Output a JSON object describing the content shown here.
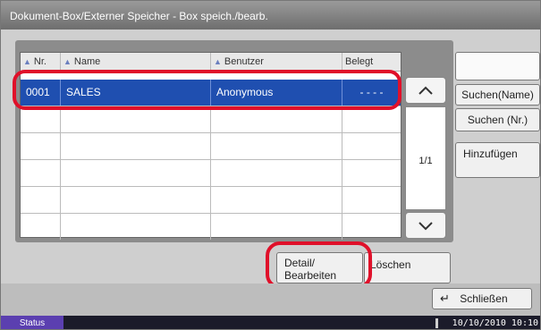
{
  "window": {
    "title": "Dokument-Box/Externer Speicher - Box speich./bearb."
  },
  "table": {
    "columns": [
      {
        "label": "Nr."
      },
      {
        "label": "Name"
      },
      {
        "label": "Benutzer"
      },
      {
        "label": "Belegt"
      }
    ],
    "rows": [
      {
        "nr": "0001",
        "name": "SALES",
        "user": "Anonymous",
        "used": "- - - -"
      },
      {
        "nr": "",
        "name": "",
        "user": "",
        "used": ""
      },
      {
        "nr": "",
        "name": "",
        "user": "",
        "used": ""
      },
      {
        "nr": "",
        "name": "",
        "user": "",
        "used": ""
      },
      {
        "nr": "",
        "name": "",
        "user": "",
        "used": ""
      },
      {
        "nr": "",
        "name": "",
        "user": "",
        "used": ""
      }
    ]
  },
  "pagination": {
    "page": "1/1"
  },
  "side": {
    "search_name": "Suchen(Name)",
    "search_nr": "Suchen (Nr.)",
    "add": "Hinzufügen"
  },
  "actions": {
    "detail_line1": "Detail/",
    "detail_line2": "Bearbeiten",
    "delete": "Löschen",
    "close": "Schließen"
  },
  "status": {
    "label": "Status",
    "datetime": "10/10/2010  10:10"
  },
  "colors": {
    "selected_row": "#1f4fb0",
    "highlight": "#e0102a",
    "status_accent": "#5b3fb0"
  }
}
